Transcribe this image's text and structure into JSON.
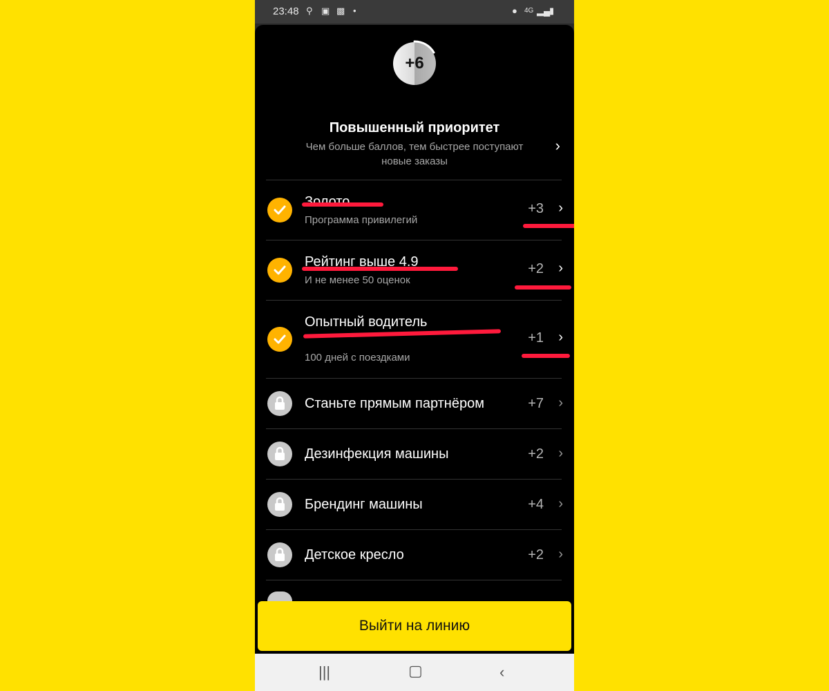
{
  "statusbar": {
    "time": "23:48",
    "network": "4G"
  },
  "badge": {
    "value": "+6"
  },
  "header": {
    "title": "Повышенный приоритет",
    "subtitle": "Чем больше баллов, тем быстрее поступают новые заказы"
  },
  "rows": [
    {
      "title": "Золото",
      "subtitle": "Программа привилегий",
      "points": "+3",
      "state": "done"
    },
    {
      "title": "Рейтинг выше 4.9",
      "subtitle": "И не менее 50 оценок",
      "points": "+2",
      "state": "done"
    },
    {
      "title": "Опытный водитель",
      "subtitle": "100 дней с поездками",
      "points": "+1",
      "state": "done"
    },
    {
      "title": "Станьте прямым партнёром",
      "points": "+7",
      "state": "locked"
    },
    {
      "title": "Дезинфекция машины",
      "points": "+2",
      "state": "locked"
    },
    {
      "title": "Брендинг машины",
      "points": "+4",
      "state": "locked"
    },
    {
      "title": "Детское кресло",
      "points": "+2",
      "state": "locked"
    }
  ],
  "cta": {
    "label": "Выйти на линию"
  },
  "colors": {
    "background": "#FFE100",
    "accent": "#FFB300",
    "annotation": "#ff1a3c",
    "sheet": "#000000"
  },
  "icons": [
    "search-icon",
    "image-icon",
    "location-icon",
    "signal-icon",
    "battery-icon",
    "check-icon",
    "lock-icon",
    "chevron-right-icon",
    "recent-apps-icon",
    "home-icon",
    "back-icon"
  ]
}
